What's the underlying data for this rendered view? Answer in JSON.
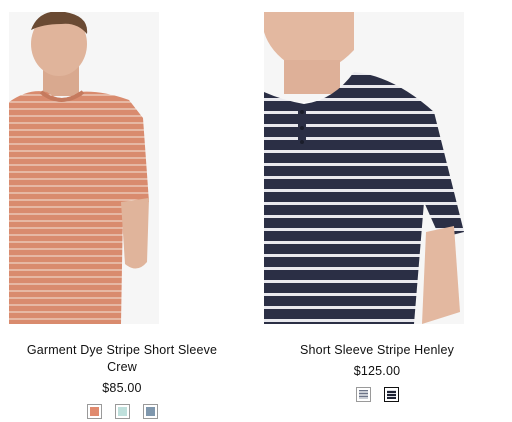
{
  "products": [
    {
      "name": "Garment Dye Stripe Short Sleeve Crew",
      "price": "$85.00",
      "swatches": [
        {
          "color_name": "coral",
          "hex": "#e08a6e"
        },
        {
          "color_name": "aqua",
          "hex": "#bfe0dc"
        },
        {
          "color_name": "slate-blue",
          "hex": "#7f97ad"
        }
      ]
    },
    {
      "name": "Short Sleeve Stripe Henley",
      "price": "$125.00",
      "swatches": [
        {
          "color_name": "light-gray-stripe",
          "hex": "#c8ccd4"
        },
        {
          "color_name": "navy-stripe",
          "hex": "#1d2233"
        }
      ]
    }
  ],
  "colors": {
    "coral_shirt": "#d98b6e",
    "navy_shirt": "#2b2f45",
    "stripe_white": "#f2ece6"
  }
}
